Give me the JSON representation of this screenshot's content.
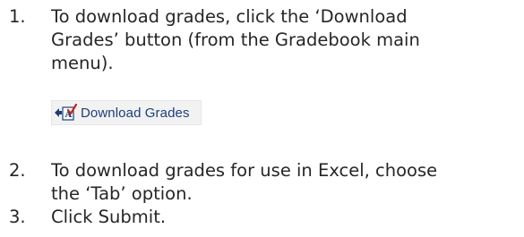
{
  "steps": [
    {
      "number": "1.",
      "lines": [
        "To download grades, click the ‘Download",
        "Grades’ button (from the Gradebook main",
        "menu)."
      ]
    },
    {
      "number": "2.",
      "lines": [
        "To download grades for use in Excel, choose",
        "the ‘Tab’ option."
      ]
    },
    {
      "number": "3.",
      "lines": [
        "Click Submit."
      ]
    }
  ],
  "download_button": {
    "label": "Download Grades",
    "icon": "download-grades-icon"
  },
  "colors": {
    "text": "#262626",
    "button_bg": "#f2f2f2",
    "button_text": "#1b3f78",
    "icon_red": "#c0281f",
    "icon_blue": "#1b3f78"
  }
}
